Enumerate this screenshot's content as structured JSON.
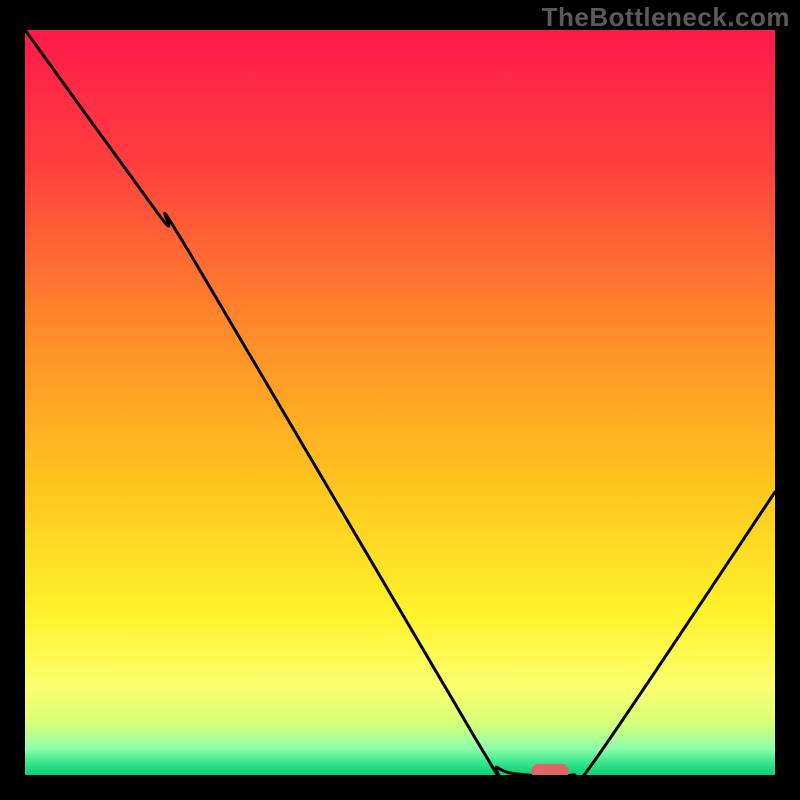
{
  "watermark": "TheBottleneck.com",
  "chart_data": {
    "type": "line",
    "title": "",
    "xlabel": "",
    "ylabel": "",
    "xlim": [
      0,
      100
    ],
    "ylim": [
      0,
      100
    ],
    "grid": false,
    "legend": false,
    "curve": {
      "name": "bottleneck-curve",
      "color": "#000000",
      "stroke_width": 3,
      "points": [
        {
          "x": 0,
          "y": 100
        },
        {
          "x": 18,
          "y": 75
        },
        {
          "x": 22,
          "y": 70
        },
        {
          "x": 60,
          "y": 5
        },
        {
          "x": 63,
          "y": 1
        },
        {
          "x": 67,
          "y": 0
        },
        {
          "x": 73,
          "y": 0
        },
        {
          "x": 76,
          "y": 2
        },
        {
          "x": 100,
          "y": 38
        }
      ]
    },
    "marker": {
      "name": "optimal-marker",
      "x": 70,
      "y": 0.5,
      "width": 5,
      "height": 2,
      "color": "#e06666"
    },
    "background_gradient": {
      "type": "vertical",
      "stops": [
        {
          "offset": 0.0,
          "color": "#ff1a4b"
        },
        {
          "offset": 0.18,
          "color": "#ff3f3f"
        },
        {
          "offset": 0.4,
          "color": "#ff8a2a"
        },
        {
          "offset": 0.6,
          "color": "#ffc21f"
        },
        {
          "offset": 0.78,
          "color": "#fff22a"
        },
        {
          "offset": 0.88,
          "color": "#fdff6e"
        },
        {
          "offset": 0.93,
          "color": "#d7ff7a"
        },
        {
          "offset": 0.965,
          "color": "#8dffab"
        },
        {
          "offset": 0.985,
          "color": "#33e28a"
        },
        {
          "offset": 1.0,
          "color": "#0ccf74"
        }
      ]
    }
  }
}
